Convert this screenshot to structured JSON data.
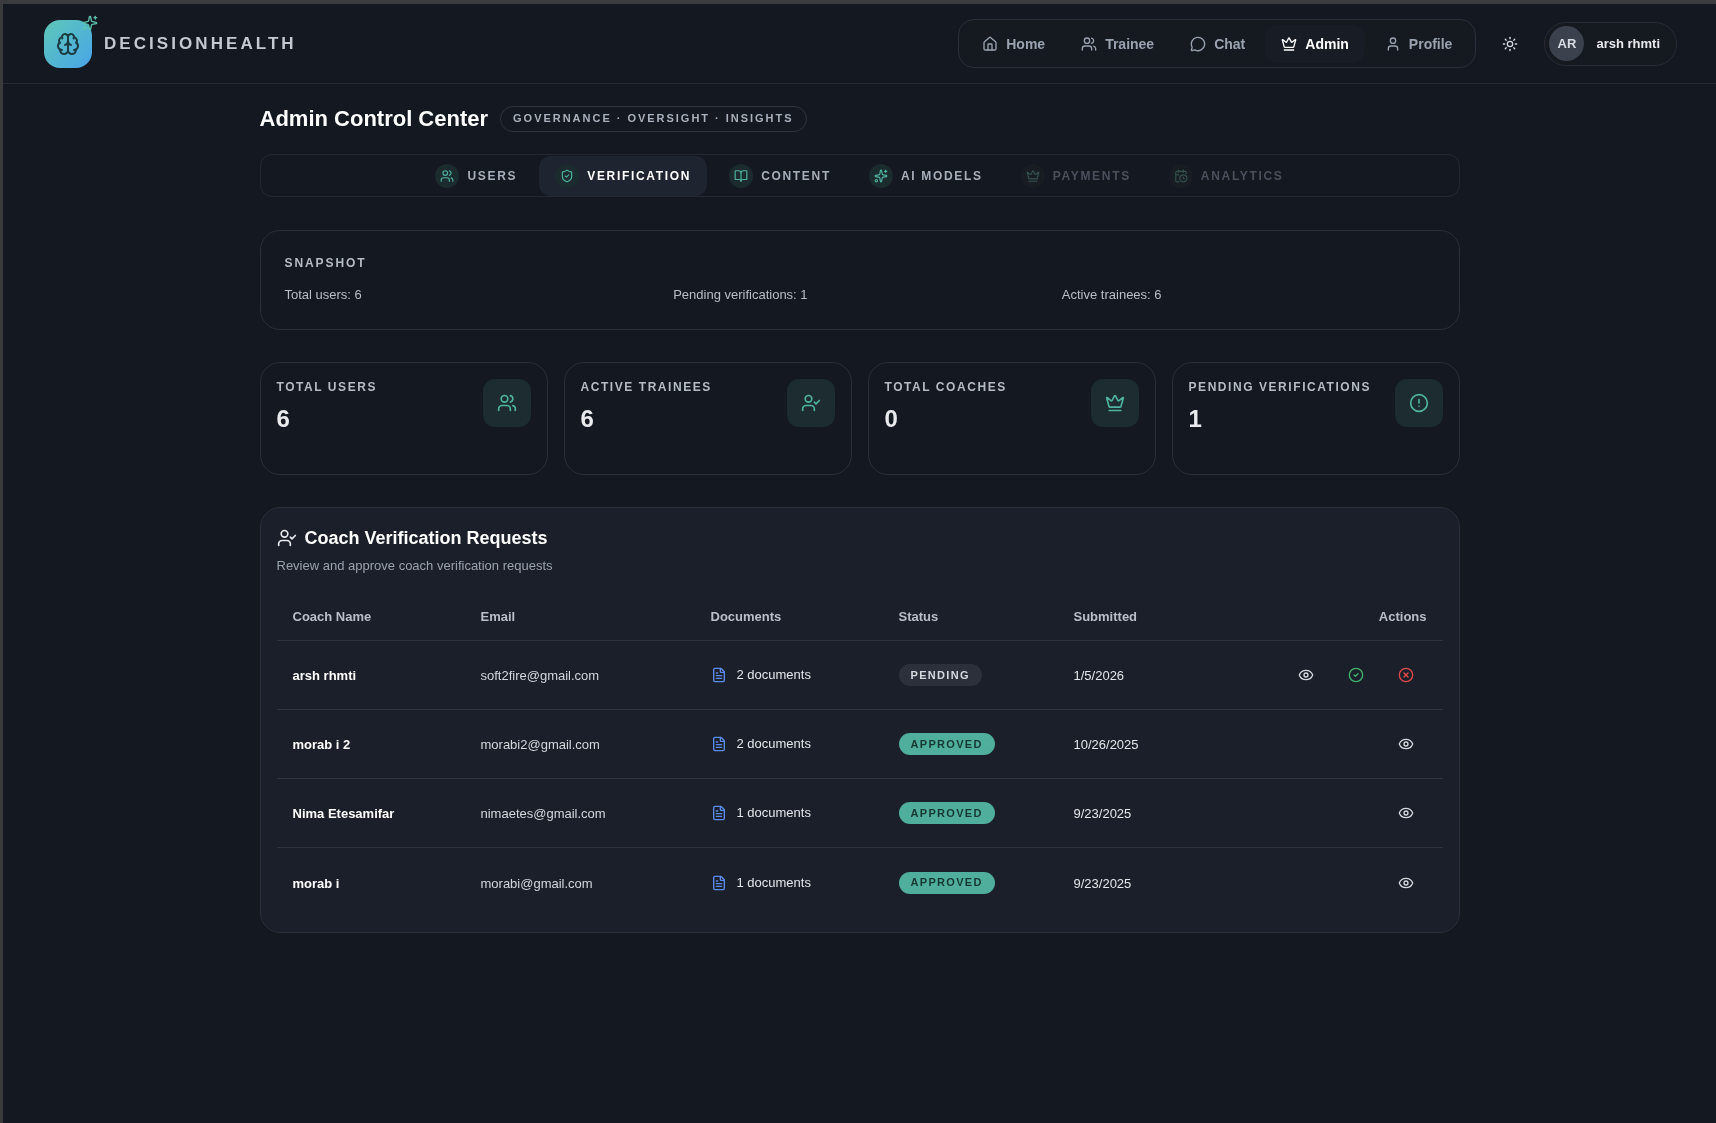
{
  "header": {
    "brand": "DECISIONHEALTH",
    "nav": [
      {
        "label": "Home",
        "selected": false
      },
      {
        "label": "Trainee",
        "selected": false
      },
      {
        "label": "Chat",
        "selected": false
      },
      {
        "label": "Admin",
        "selected": true
      },
      {
        "label": "Profile",
        "selected": false
      }
    ],
    "user": {
      "initials": "AR",
      "name": "arsh rhmti"
    }
  },
  "page": {
    "title": "Admin Control Center",
    "badge": "GOVERNANCE · OVERSIGHT · INSIGHTS"
  },
  "tabs": [
    {
      "label": "USERS",
      "selected": false,
      "disabled": false
    },
    {
      "label": "VERIFICATION",
      "selected": true,
      "disabled": false
    },
    {
      "label": "CONTENT",
      "selected": false,
      "disabled": false
    },
    {
      "label": "AI MODELS",
      "selected": false,
      "disabled": false
    },
    {
      "label": "PAYMENTS",
      "selected": false,
      "disabled": true
    },
    {
      "label": "ANALYTICS",
      "selected": false,
      "disabled": true
    }
  ],
  "snapshot": {
    "title": "SNAPSHOT",
    "items": [
      "Total users: 6",
      "Pending verifications: 1",
      "Active trainees: 6"
    ]
  },
  "stats": [
    {
      "label": "TOTAL USERS",
      "value": "6"
    },
    {
      "label": "ACTIVE TRAINEES",
      "value": "6"
    },
    {
      "label": "TOTAL COACHES",
      "value": "0"
    },
    {
      "label": "PENDING VERIFICATIONS",
      "value": "1"
    }
  ],
  "verification": {
    "title": "Coach Verification Requests",
    "subtitle": "Review and approve coach verification requests",
    "table": {
      "columns": [
        "Coach Name",
        "Email",
        "Documents",
        "Status",
        "Submitted",
        "Actions"
      ],
      "rows": [
        {
          "name": "arsh rhmti",
          "email": "soft2fire@gmail.com",
          "documents": "2 documents",
          "status": {
            "label": "PENDING",
            "kind": "pending"
          },
          "submitted": "1/5/2026",
          "actions": [
            {
              "kind": "view"
            },
            {
              "kind": "approve"
            },
            {
              "kind": "reject"
            }
          ]
        },
        {
          "name": "morab i 2",
          "email": "morabi2@gmail.com",
          "documents": "2 documents",
          "status": {
            "label": "APPROVED",
            "kind": "approved"
          },
          "submitted": "10/26/2025",
          "actions": [
            {
              "kind": "view"
            }
          ]
        },
        {
          "name": "Nima Etesamifar",
          "email": "nimaetes@gmail.com",
          "documents": "1 documents",
          "status": {
            "label": "APPROVED",
            "kind": "approved"
          },
          "submitted": "9/23/2025",
          "actions": [
            {
              "kind": "view"
            }
          ]
        },
        {
          "name": "morab i",
          "email": "morabi@gmail.com",
          "documents": "1 documents",
          "status": {
            "label": "APPROVED",
            "kind": "approved"
          },
          "submitted": "9/23/2025",
          "actions": [
            {
              "kind": "view"
            }
          ]
        }
      ]
    }
  }
}
